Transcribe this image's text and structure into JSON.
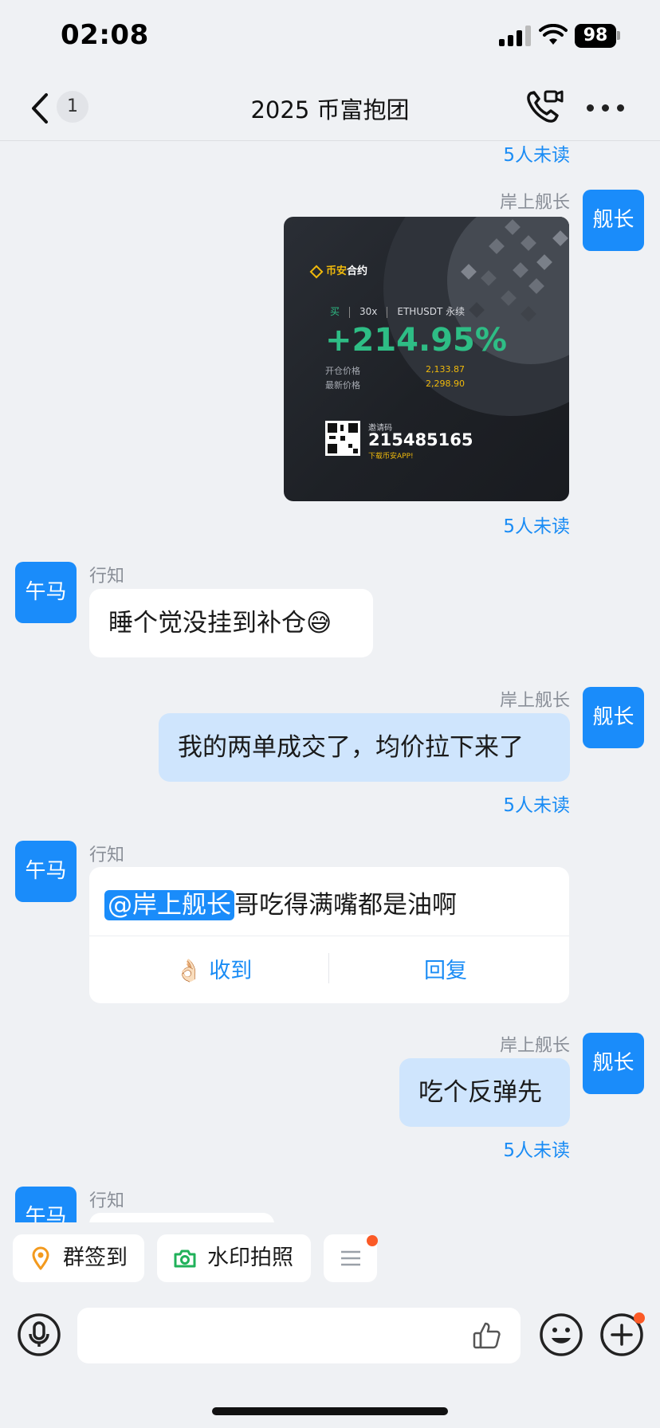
{
  "status_bar": {
    "time": "02:08",
    "battery": "98"
  },
  "nav": {
    "back_badge": "1",
    "title": "2025 币富抱团"
  },
  "messages": {
    "top_unread": "5人未读",
    "m1": {
      "sender": "岸上舰长",
      "avatar": "舰长",
      "unread": "5人未读",
      "card": {
        "brand_prefix": "币安",
        "brand_suffix": "合约",
        "side": "买",
        "leverage": "30x",
        "symbol": "ETHUSDT 永续",
        "pnl": "+214.95%",
        "entry_label": "开仓价格",
        "entry_value": "2,133.87",
        "last_label": "最新价格",
        "last_value": "2,298.90",
        "invite_label": "邀请码",
        "invite_code": "215485165",
        "download_text": "下载币安APP!"
      }
    },
    "m2": {
      "sender": "行知",
      "avatar": "午马",
      "text": "睡个觉没挂到补仓😅"
    },
    "m3": {
      "sender": "岸上舰长",
      "avatar": "舰长",
      "text": "我的两单成交了，均价拉下来了",
      "unread": "5人未读"
    },
    "m4": {
      "sender": "行知",
      "avatar": "午马",
      "mention": "@岸上舰长",
      "text": "哥吃得满嘴都是油啊",
      "ack_emoji": "👌🏻",
      "ack_label": "收到",
      "reply_label": "回复"
    },
    "m5": {
      "sender": "岸上舰长",
      "avatar": "舰长",
      "text": "吃个反弹先",
      "unread": "5人未读"
    },
    "m6": {
      "sender": "行知",
      "avatar": "午马"
    }
  },
  "quick_actions": {
    "checkin": "群签到",
    "watermark": "水印拍照"
  },
  "colors": {
    "accent": "#1a8cfa",
    "self_bubble": "#cfe5fd",
    "profit_green": "#2ebd85",
    "binance_yellow": "#f0b90b"
  }
}
